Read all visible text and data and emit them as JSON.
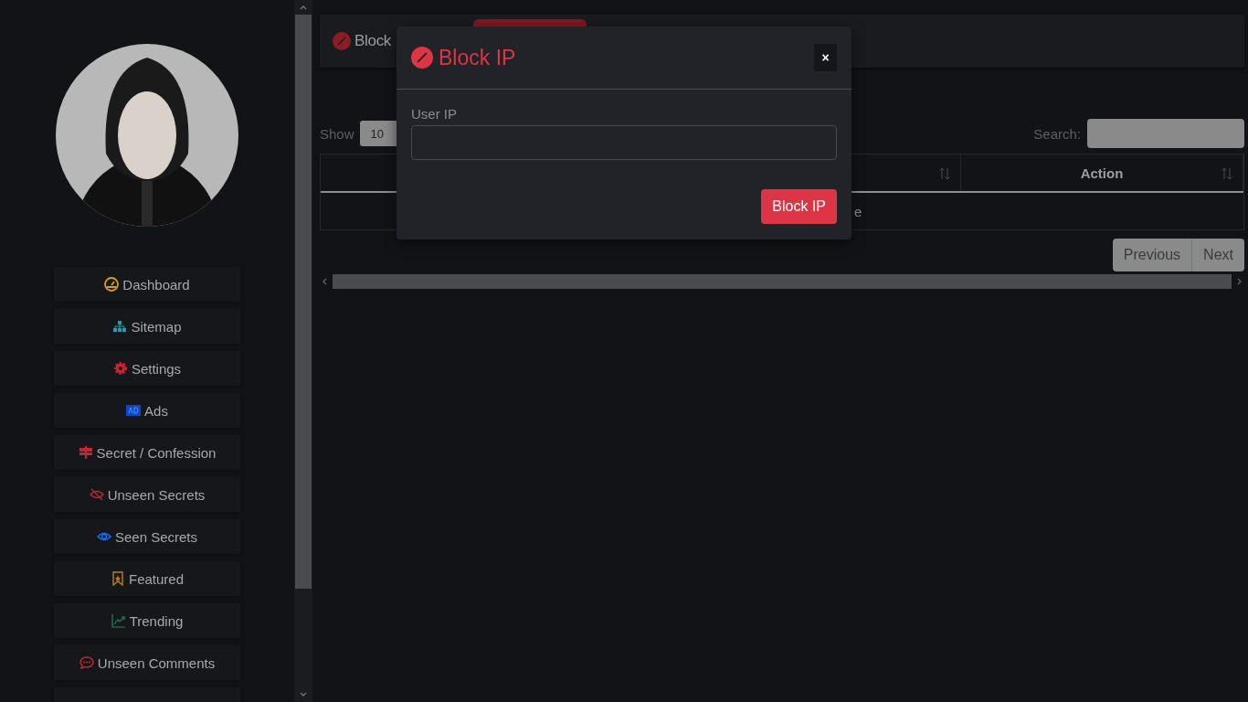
{
  "sidebar": {
    "items": [
      {
        "label": "Dashboard"
      },
      {
        "label": "Sitemap"
      },
      {
        "label": "Settings"
      },
      {
        "label": "Ads"
      },
      {
        "label": "Secret / Confession"
      },
      {
        "label": "Unseen Secrets"
      },
      {
        "label": "Seen Secrets"
      },
      {
        "label": "Featured"
      },
      {
        "label": "Trending"
      },
      {
        "label": "Unseen Comments"
      }
    ]
  },
  "header": {
    "title": "Block"
  },
  "table_controls": {
    "show_label": "Show",
    "show_value": "10",
    "search_label": "Search:"
  },
  "table": {
    "columns": [
      {
        "label": "Action"
      }
    ],
    "empty_fragment": "e"
  },
  "pagination": [
    "Previous",
    "Next"
  ],
  "modal": {
    "title": "Block IP",
    "close": "×",
    "field_label": "User IP",
    "submit": "Block IP"
  }
}
